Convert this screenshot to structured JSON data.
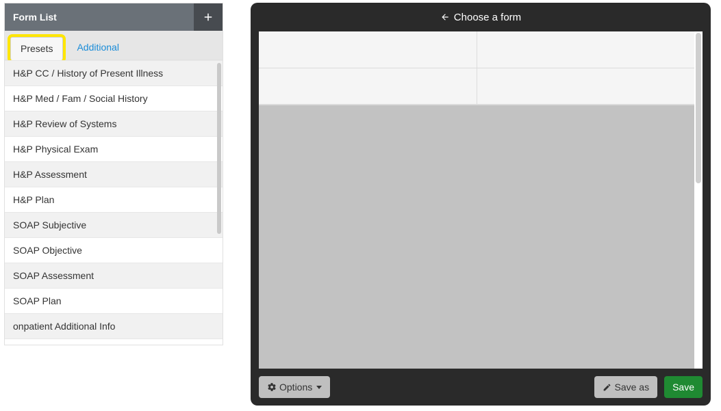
{
  "sidebar": {
    "title": "Form List",
    "tabs": [
      {
        "label": "Presets",
        "active": true,
        "highlighted": true
      },
      {
        "label": "Additional",
        "active": false,
        "highlighted": false
      }
    ],
    "items": [
      "H&P CC / History of Present Illness",
      "H&P Med / Fam / Social History",
      "H&P Review of Systems",
      "H&P Physical Exam",
      "H&P Assessment",
      "H&P Plan",
      "SOAP Subjective",
      "SOAP Objective",
      "SOAP Assessment",
      "SOAP Plan",
      "onpatient Additional Info"
    ]
  },
  "editor": {
    "header_label": "Choose a form",
    "options_label": "Options",
    "save_as_label": "Save as",
    "save_label": "Save"
  }
}
